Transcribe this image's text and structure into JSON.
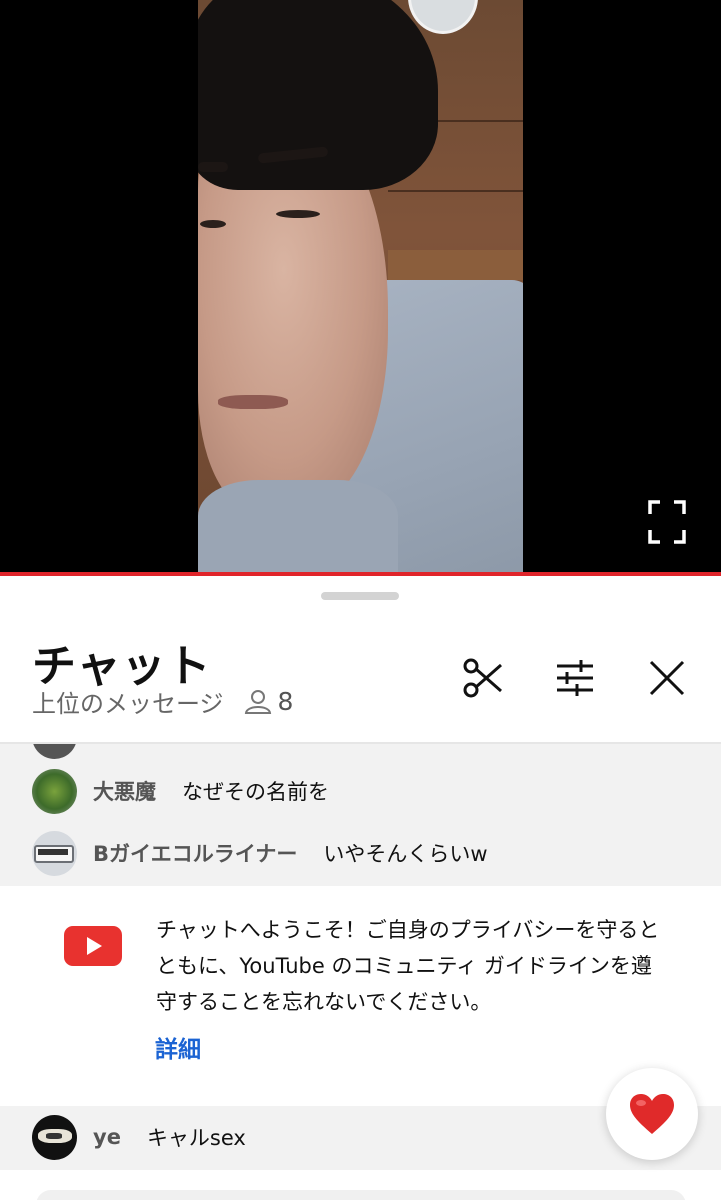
{
  "chat": {
    "title": "チャット",
    "mode_label": "上位のメッセージ",
    "viewer_count": "8"
  },
  "header_icons": {
    "clip": "scissors-icon",
    "filter": "tune-sliders-icon",
    "close": "close-x-icon"
  },
  "messages": [
    {
      "author": "大悪魔",
      "text": "なぜその名前を",
      "avatar": "green-robot-avatar"
    },
    {
      "author": "Bガイエコルライナー",
      "text": "いやそんくらいw",
      "avatar": "bus-avatar"
    }
  ],
  "welcome": {
    "text": "チャットへようこそ！ご自身のプライバシーを守るとともに、YouTube のコミュニティ ガイドラインを遵守することを忘れないでください。",
    "link": "詳細"
  },
  "last_message": {
    "author": "ye",
    "text": "キャルsex",
    "avatar": "dark-pattern-avatar"
  },
  "colors": {
    "accent_red": "#e0242a",
    "link_blue": "#1b63d3",
    "heart_red": "#e02a2a"
  }
}
